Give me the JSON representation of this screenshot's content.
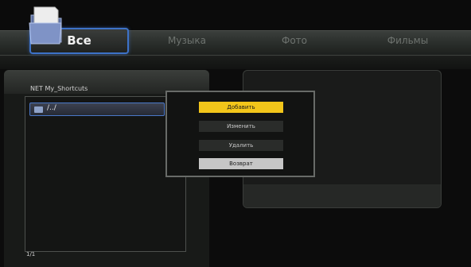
{
  "tabs": [
    {
      "label": "Все",
      "active": true
    },
    {
      "label": "Музыка",
      "active": false
    },
    {
      "label": "Фото",
      "active": false
    },
    {
      "label": "Фильмы",
      "active": false
    }
  ],
  "browser": {
    "title": "NET My_Shortcuts",
    "items": [
      {
        "label": "/../",
        "icon": "folder-icon"
      }
    ],
    "page": "1/1"
  },
  "menu": {
    "add": "Добавить",
    "edit": "Изменить",
    "delete": "Удалить",
    "back": "Возврат"
  },
  "colors": {
    "highlight": "#f2c51a",
    "focus_border": "#3d72c8"
  }
}
